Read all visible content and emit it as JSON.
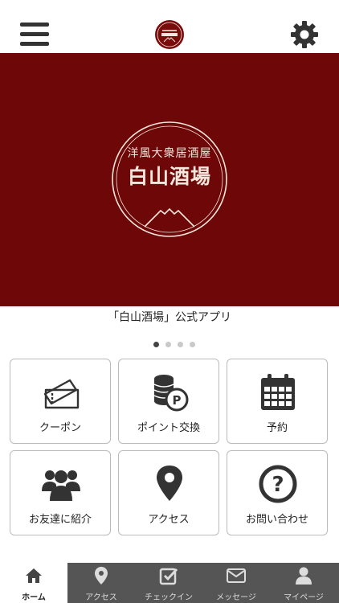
{
  "header": {
    "menu_icon": "hamburger-menu-icon",
    "settings_icon": "gear-icon",
    "logo": "restaurant-logo"
  },
  "hero": {
    "subtitle": "洋風大衆居酒屋",
    "title": "白山酒場",
    "background_color": "#6e0707"
  },
  "carousel": {
    "caption": "「白山酒場」公式アプリ",
    "page_count": 4,
    "active_index": 0
  },
  "tiles": [
    {
      "label": "クーポン",
      "icon": "ticket-icon"
    },
    {
      "label": "ポイント交換",
      "icon": "coins-points-icon"
    },
    {
      "label": "予約",
      "icon": "calendar-icon"
    },
    {
      "label": "お友達に紹介",
      "icon": "users-icon"
    },
    {
      "label": "アクセス",
      "icon": "map-pin-icon"
    },
    {
      "label": "お問い合わせ",
      "icon": "question-icon"
    }
  ],
  "tabbar": {
    "items": [
      {
        "label": "ホーム",
        "icon": "home-icon",
        "active": true
      },
      {
        "label": "アクセス",
        "icon": "map-pin-icon",
        "active": false
      },
      {
        "label": "チェックイン",
        "icon": "checkbox-icon",
        "active": false
      },
      {
        "label": "メッセージ",
        "icon": "mail-icon",
        "active": false
      },
      {
        "label": "マイページ",
        "icon": "user-icon",
        "active": false
      }
    ]
  },
  "colors": {
    "brand": "#6e0707",
    "tab_bar": "#555555",
    "icon": "#333333"
  }
}
